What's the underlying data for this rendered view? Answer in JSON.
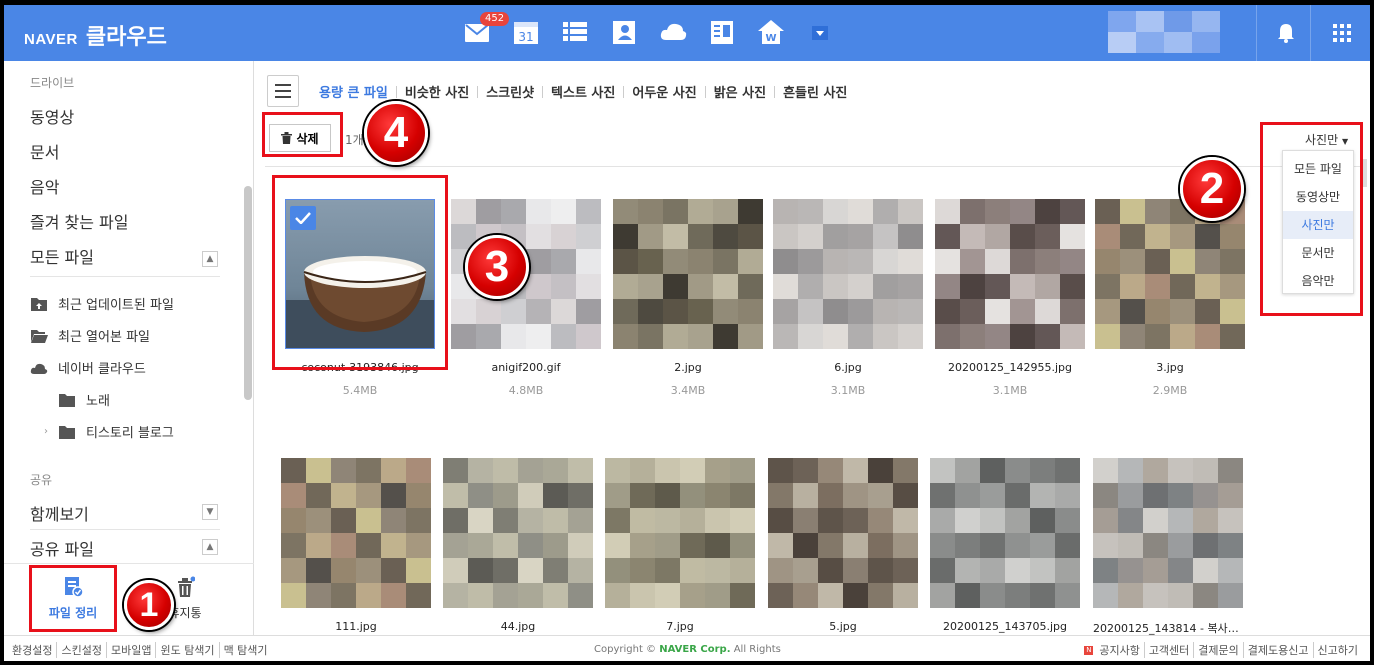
{
  "header": {
    "brand": "NAVER",
    "service": "클라우드",
    "mail_badge": "452",
    "calendar_day": "31",
    "colors": {
      "header_bg": "#4a86e6",
      "accent": "#3d7ae0",
      "annotation_red": "#e8101a"
    },
    "apps": [
      "mail-icon",
      "calendar-icon",
      "list-icon",
      "contacts-icon",
      "cloud-icon",
      "memo-icon",
      "office-icon",
      "more-dropdown-icon"
    ]
  },
  "sidebar": {
    "drive_title": "드라이브",
    "items": [
      "동영상",
      "문서",
      "음악",
      "즐겨 찾는 파일",
      "모든 파일"
    ],
    "tree": [
      "최근 업데이트된 파일",
      "최근 열어본 파일",
      "네이버 클라우드",
      "노래",
      "티스토리 블로그"
    ],
    "share_title": "공유",
    "share_items": [
      "함께보기",
      "공유 파일"
    ],
    "tools": {
      "organize": "파일 정리",
      "trash": "휴지통"
    }
  },
  "main": {
    "tabs": [
      "용량 큰 파일",
      "비슷한 사진",
      "스크린샷",
      "텍스트 사진",
      "어두운 사진",
      "밝은 사진",
      "흔들린 사진"
    ],
    "delete_label": "삭제",
    "selection_info": "1개 선택됨",
    "filter_selected": "사진만",
    "filter_options": [
      "모든 파일",
      "동영상만",
      "사진만",
      "문서만",
      "음악만"
    ],
    "files_row1": [
      {
        "name": "coconut-3193846.jpg",
        "size": "5.4MB"
      },
      {
        "name": "anigif200.gif",
        "size": "4.8MB"
      },
      {
        "name": "2.jpg",
        "size": "3.4MB"
      },
      {
        "name": "6.jpg",
        "size": "3.1MB"
      },
      {
        "name": "20200125_142955.jpg",
        "size": "3.1MB"
      },
      {
        "name": "3.jpg",
        "size": "2.9MB"
      }
    ],
    "files_row2": [
      {
        "name": "111.jpg"
      },
      {
        "name": "44.jpg"
      },
      {
        "name": "7.jpg"
      },
      {
        "name": "5.jpg"
      },
      {
        "name": "20200125_143705.jpg"
      },
      {
        "name": "20200125_143814 - 복사본.jpg"
      }
    ]
  },
  "annotations": [
    "1",
    "2",
    "3",
    "4"
  ],
  "footer": {
    "left": [
      "환경설정",
      "스킨설정",
      "모바일앱",
      "윈도 탐색기",
      "맥 탐색기"
    ],
    "copyright_prefix": "Copyright ©",
    "copyright_brand": "NAVER Corp.",
    "copyright_suffix": "All Rights",
    "right": [
      "공지사항",
      "고객센터",
      "결제문의",
      "결제도용신고",
      "신고하기"
    ]
  }
}
